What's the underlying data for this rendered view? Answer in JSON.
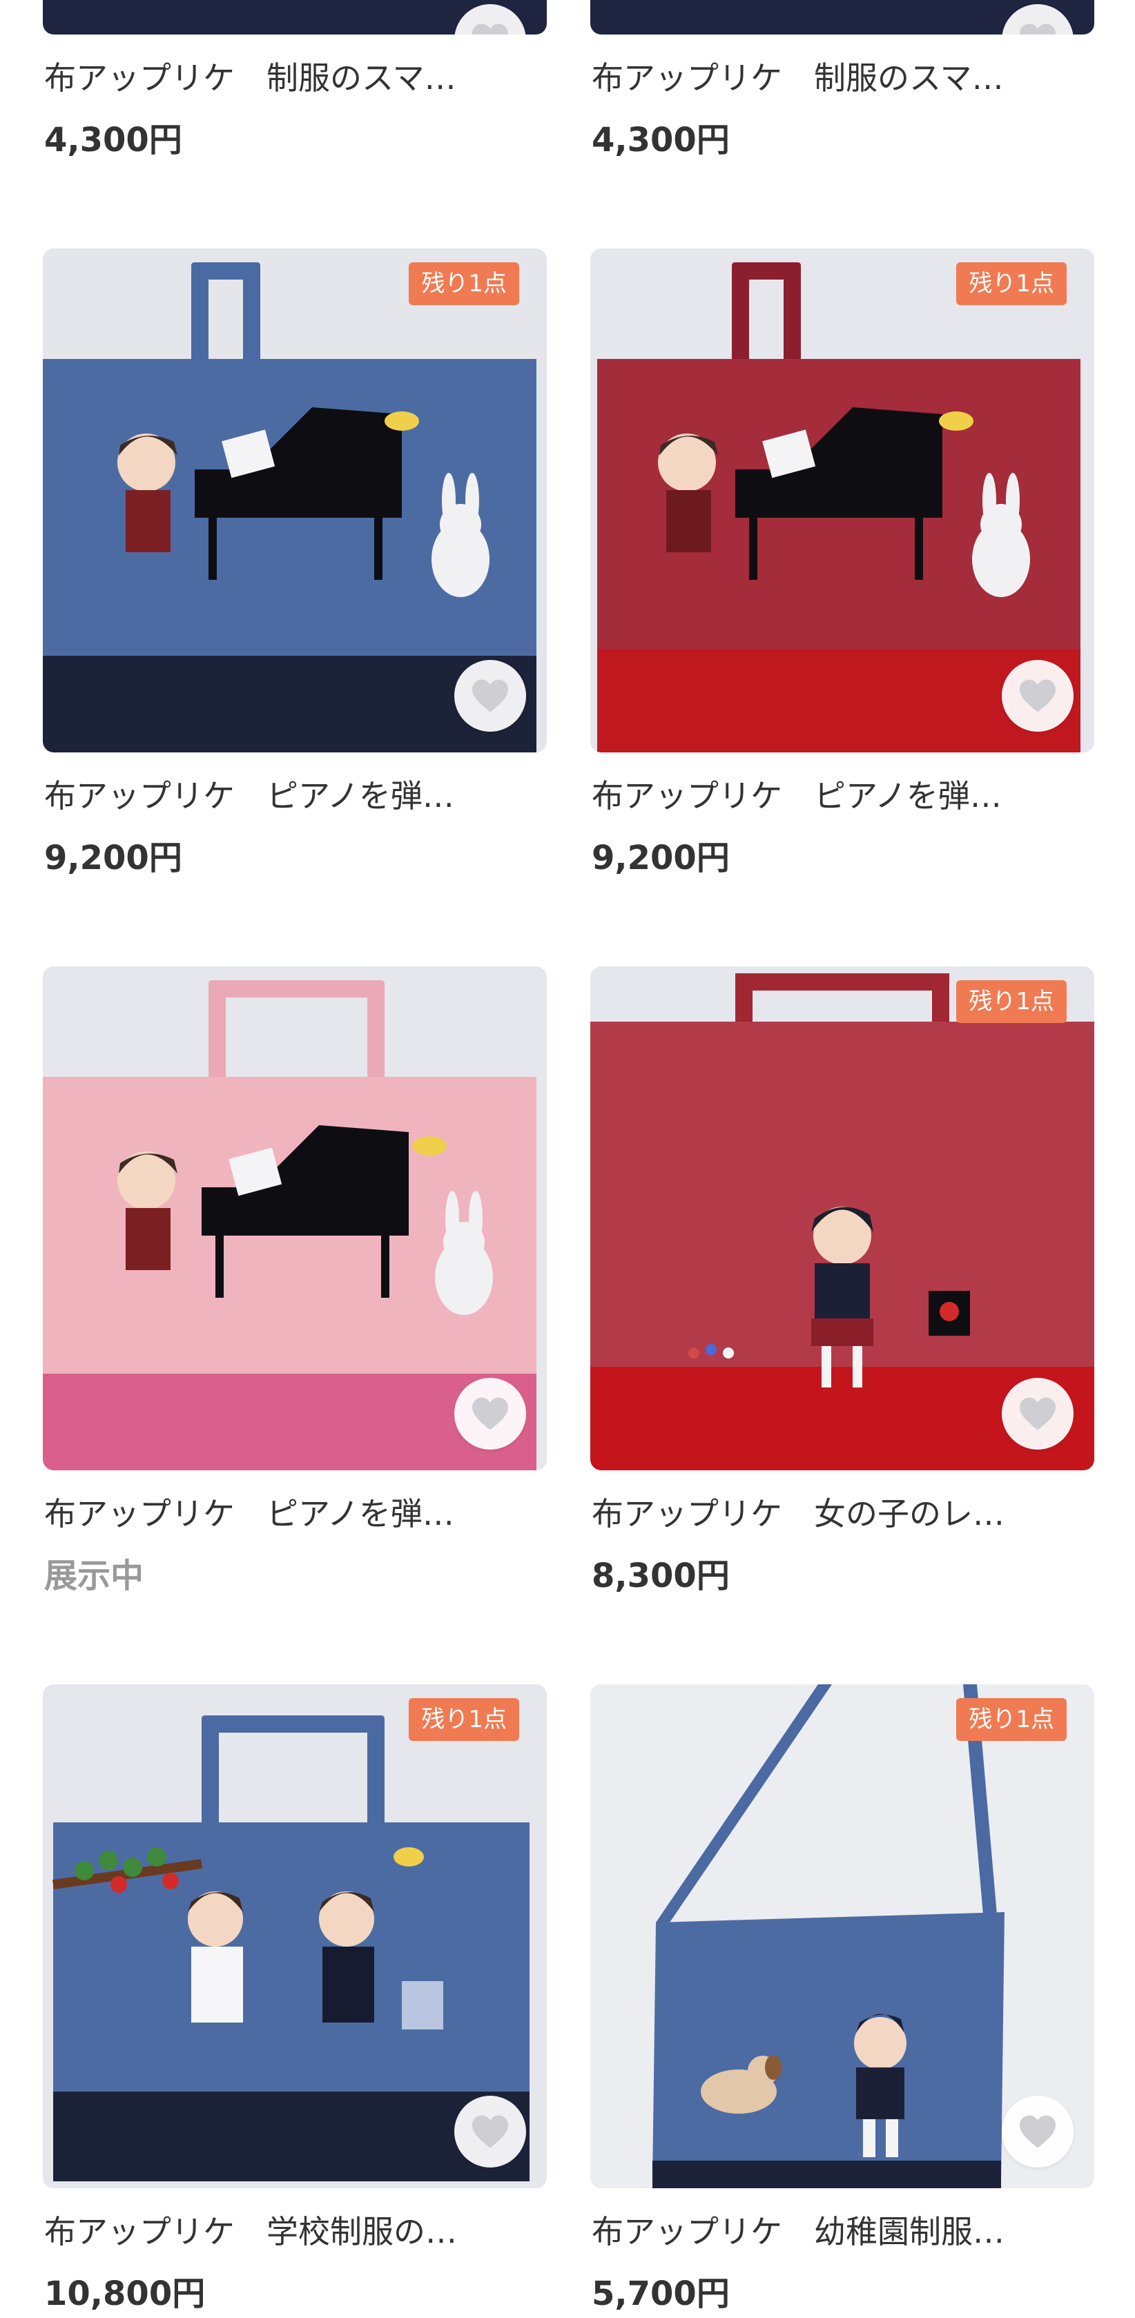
{
  "colors": {
    "badge": "#f07a52",
    "heart": "#cfcfd3",
    "price_text": "#333333",
    "status_muted": "#999999"
  },
  "favorite_icon": "heart-icon",
  "products": [
    {
      "title": "布アップリケ　制服のスマ…",
      "price": "4,300円",
      "badge": "",
      "image": "navy-tote-top-cropped"
    },
    {
      "title": "布アップリケ　制服のスマ…",
      "price": "4,300円",
      "badge": "",
      "image": "navy-tote-top-cropped"
    },
    {
      "title": "布アップリケ　ピアノを弾…",
      "price": "9,200円",
      "badge": "残り1点",
      "image": "blue-tote-piano-girl-rabbit"
    },
    {
      "title": "布アップリケ　ピアノを弾…",
      "price": "9,200円",
      "badge": "残り1点",
      "image": "red-tote-piano-girl-rabbit"
    },
    {
      "title": "布アップリケ　ピアノを弾…",
      "price": "展示中",
      "badge": "",
      "image": "pink-tote-piano-girl-rabbit"
    },
    {
      "title": "布アップリケ　女の子のレ…",
      "price": "8,300円",
      "badge": "残り1点",
      "image": "red-tote-girl-uniform"
    },
    {
      "title": "布アップリケ　学校制服の…",
      "price": "10,800円",
      "badge": "残り1点",
      "image": "blue-tote-two-schoolgirls"
    },
    {
      "title": "布アップリケ　幼稚園制服…",
      "price": "5,700円",
      "badge": "残り1点",
      "image": "blue-shoulder-bag-boy-dog"
    }
  ]
}
